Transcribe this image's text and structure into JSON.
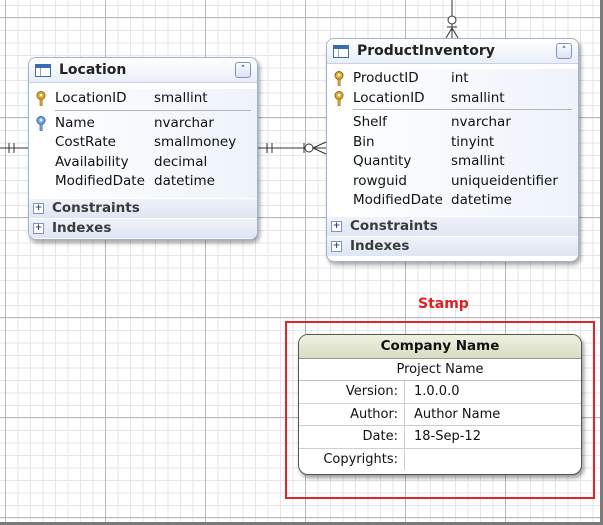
{
  "location": {
    "title": "Location",
    "collapse": "˄",
    "key_fields": [
      {
        "name": "LocationID",
        "type": "smallint"
      }
    ],
    "fields": [
      {
        "name": "Name",
        "type": "nvarchar",
        "icon": "index-key-icon"
      },
      {
        "name": "CostRate",
        "type": "smallmoney"
      },
      {
        "name": "Availability",
        "type": "decimal"
      },
      {
        "name": "ModifiedDate",
        "type": "datetime"
      }
    ],
    "sections": [
      "Constraints",
      "Indexes"
    ]
  },
  "product_inventory": {
    "title": "ProductInventory",
    "collapse": "˄",
    "key_fields": [
      {
        "name": "ProductID",
        "type": "int"
      },
      {
        "name": "LocationID",
        "type": "smallint"
      }
    ],
    "fields": [
      {
        "name": "Shelf",
        "type": "nvarchar"
      },
      {
        "name": "Bin",
        "type": "tinyint"
      },
      {
        "name": "Quantity",
        "type": "smallint"
      },
      {
        "name": "rowguid",
        "type": "uniqueidentifier"
      },
      {
        "name": "ModifiedDate",
        "type": "datetime"
      }
    ],
    "sections": [
      "Constraints",
      "Indexes"
    ]
  },
  "stamp": {
    "label": "Stamp",
    "company": "Company Name",
    "project": "Project Name",
    "rows": [
      {
        "key": "Version:",
        "value": "1.0.0.0"
      },
      {
        "key": "Author:",
        "value": "Author Name"
      },
      {
        "key": "Date:",
        "value": "18-Sep-12"
      },
      {
        "key": "Copyrights:",
        "value": ""
      }
    ]
  },
  "colors": {
    "stamp_frame": "#e0242c",
    "stamp_label": "#e02020",
    "key_gold": "#d6a020",
    "key_blue": "#4a7fd0"
  }
}
